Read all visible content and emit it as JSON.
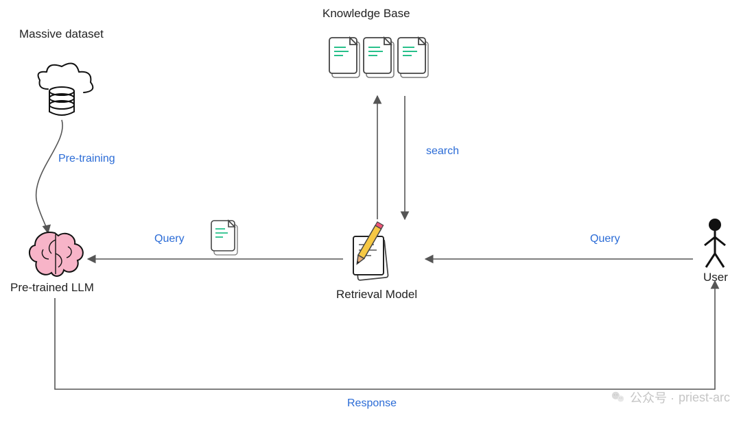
{
  "nodes": {
    "knowledge_base": {
      "label": "Knowledge Base"
    },
    "massive_dataset": {
      "label": "Massive dataset"
    },
    "pretrained_llm": {
      "label": "Pre-trained LLM"
    },
    "retrieval_model": {
      "label": "Retrieval Model"
    },
    "user": {
      "label": "User"
    }
  },
  "edges": {
    "dataset_to_llm": {
      "label": "Pre-training"
    },
    "kb_search": {
      "label": "search"
    },
    "retrieval_to_llm": {
      "label": "Query"
    },
    "user_to_retrieval": {
      "label": "Query"
    },
    "llm_to_user": {
      "label": "Response"
    }
  },
  "watermark": {
    "prefix": "公众号 · ",
    "name": "priest-arc"
  },
  "icons": {
    "dataset": "cloud-db-icon",
    "kb_docs": "documents-icon",
    "llm": "brain-icon",
    "retrieval": "paper-pencil-icon",
    "user": "person-icon",
    "query_doc": "document-icon"
  }
}
